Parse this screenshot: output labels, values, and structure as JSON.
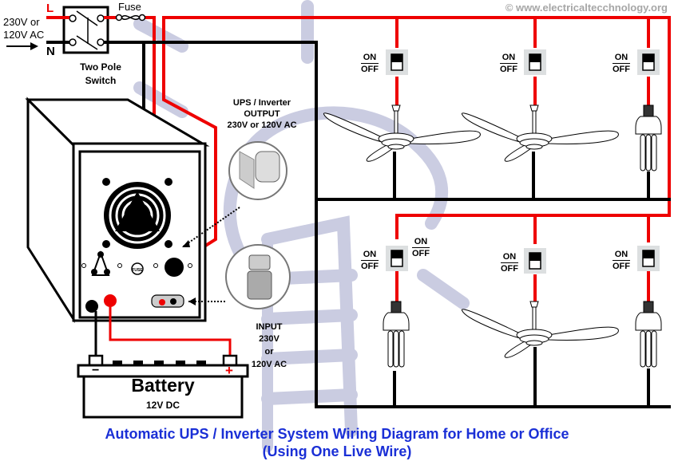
{
  "watermark": "© www.electricaltecchnology.org",
  "supply": {
    "live_label": "L",
    "neutral_label": "N",
    "voltage_line1": "230V or",
    "voltage_line2": "120V AC",
    "fuse_label": "Fuse",
    "switch_label_line1": "Two Pole",
    "switch_label_line2": "Switch"
  },
  "ups": {
    "output_line1": "UPS / Inverter",
    "output_line2": "OUTPUT",
    "output_line3": "230V or 120V AC",
    "input_line1": "INPUT",
    "input_line2": "230V",
    "input_line3": "or",
    "input_line4": "120V AC",
    "fuse_badge": "FUSE"
  },
  "battery": {
    "label": "Battery",
    "rating": "12V DC",
    "negative": "−",
    "positive": "+"
  },
  "switches": {
    "on": "ON",
    "off": "OFF"
  },
  "loads": [
    {
      "type": "ceiling-fan",
      "row": "top",
      "position": 1
    },
    {
      "type": "ceiling-fan",
      "row": "top",
      "position": 2
    },
    {
      "type": "cfl-bulb",
      "row": "top",
      "position": 3
    },
    {
      "type": "cfl-bulb",
      "row": "bottom",
      "position": 1
    },
    {
      "type": "ceiling-fan",
      "row": "bottom",
      "position": 2
    },
    {
      "type": "cfl-bulb",
      "row": "bottom",
      "position": 3
    }
  ],
  "colors": {
    "live_wire": "#ee0000",
    "neutral_wire": "#000000",
    "title": "#1a2fd6",
    "watermark_bulb": "#c8cae0",
    "switch_plate": "#dcdfe0"
  },
  "title": {
    "line1": "Automatic UPS / Inverter System Wiring Diagram for Home or Office",
    "line2": "(Using One Live Wire)"
  }
}
